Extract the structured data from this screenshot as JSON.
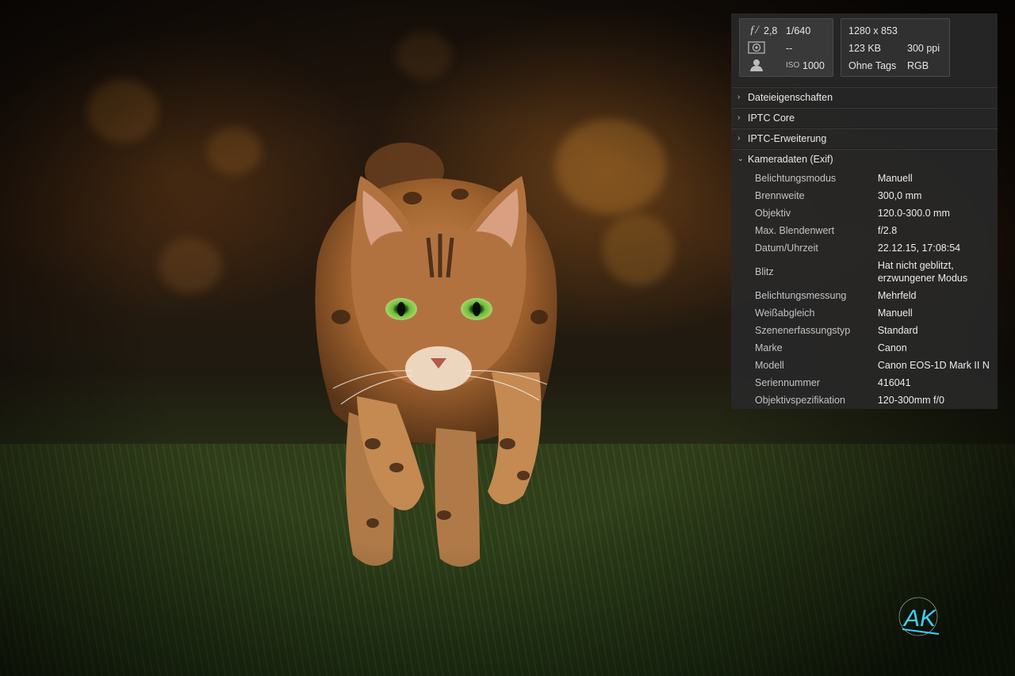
{
  "summary": {
    "aperture_symbol": "ƒ/",
    "aperture": "2,8",
    "shutter": "1/640",
    "metering_value": "--",
    "iso_label": "ISO",
    "iso_value": "1000",
    "dimensions": "1280 x 853",
    "file_size": "123 KB",
    "resolution": "300 ppi",
    "tags": "Ohne Tags",
    "color_mode": "RGB",
    "icons": [
      "metering-icon",
      "person-icon"
    ]
  },
  "sections": [
    {
      "title": "Dateieigenschaften",
      "expanded": false
    },
    {
      "title": "IPTC Core",
      "expanded": false
    },
    {
      "title": "IPTC-Erweiterung",
      "expanded": false
    },
    {
      "title": "Kameradaten (Exif)",
      "expanded": true
    }
  ],
  "exif": [
    {
      "label": "Belichtungsmodus",
      "value": "Manuell"
    },
    {
      "label": "Brennweite",
      "value": "300,0 mm"
    },
    {
      "label": "Objektiv",
      "value": "120.0-300.0 mm"
    },
    {
      "label": "Max. Blendenwert",
      "value": "f/2.8"
    },
    {
      "label": "Datum/Uhrzeit",
      "value": "22.12.15, 17:08:54"
    },
    {
      "label": "Blitz",
      "value": "Hat nicht geblitzt,",
      "value2": "erzwungener Modus"
    },
    {
      "label": "Belichtungsmessung",
      "value": "Mehrfeld"
    },
    {
      "label": "Weißabgleich",
      "value": "Manuell"
    },
    {
      "label": "Szenenerfassungstyp",
      "value": "Standard"
    },
    {
      "label": "Marke",
      "value": "Canon"
    },
    {
      "label": "Modell",
      "value": "Canon EOS-1D Mark II N"
    },
    {
      "label": "Seriennummer",
      "value": "416041"
    },
    {
      "label": "Objektivspezifikation",
      "value": "120-300mm f/0"
    }
  ],
  "watermark": {
    "text": "AK"
  },
  "colors": {
    "panel_bg": "#282828",
    "panel_text": "#dcdcdc",
    "watermark": "#3fd0ff"
  }
}
